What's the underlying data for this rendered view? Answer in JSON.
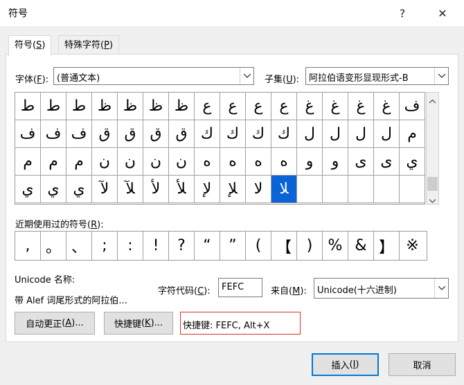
{
  "window": {
    "title": "符号",
    "help_label": "?",
    "close_label": "✕"
  },
  "tabs": [
    {
      "label": "符号",
      "key": "S"
    },
    {
      "label": "特殊字符",
      "key": "P"
    }
  ],
  "font": {
    "label": "字体",
    "key": "F",
    "value": "(普通文本)"
  },
  "subset": {
    "label": "子集",
    "key": "U",
    "value": "阿拉伯语变形显现形式-B"
  },
  "symbols": [
    [
      "ط",
      "ط",
      "ط",
      "ظ",
      "ظ",
      "ظ",
      "ظ",
      "ع",
      "ع",
      "ع",
      "ع",
      "غ",
      "غ",
      "غ",
      "غ",
      "ف"
    ],
    [
      "ف",
      "ف",
      "ف",
      "ق",
      "ق",
      "ق",
      "ق",
      "ك",
      "ك",
      "ك",
      "ك",
      "ل",
      "ل",
      "ل",
      "ل",
      "م"
    ],
    [
      "م",
      "م",
      "م",
      "ن",
      "ن",
      "ن",
      "ن",
      "ه",
      "ه",
      "ه",
      "ه",
      "و",
      "و",
      "ى",
      "ى",
      "ي"
    ],
    [
      "ي",
      "ي",
      "ي",
      "ﻵ",
      "ﻶ",
      "ﻷ",
      "ﻸ",
      "ﻹ",
      "ﻺ",
      "ﻻ",
      "ﻼ",
      "",
      "",
      "",
      "",
      ""
    ]
  ],
  "selected_cell": {
    "row": 3,
    "col": 10
  },
  "recent": {
    "label": "近期使用过的符号",
    "key": "R",
    "items": [
      ",",
      "。",
      "、",
      ";",
      ":",
      "!",
      "?",
      "“",
      "”",
      "(",
      "【",
      ")",
      "%",
      "&",
      "】",
      "※"
    ]
  },
  "unicode_name_label": "Unicode 名称:",
  "char_description": "带 Alef 词尾形式的阿拉伯...",
  "char_code": {
    "label": "字符代码",
    "key": "C",
    "value": "FEFC"
  },
  "from": {
    "label": "来自",
    "key": "M",
    "value": "Unicode(十六进制)"
  },
  "autocorrect_button": {
    "label": "自动更正",
    "key": "A",
    "suffix": "..."
  },
  "shortcut_button": {
    "label": "快捷键",
    "key": "K",
    "suffix": "..."
  },
  "shortcut_text": "快捷键: FEFC, Alt+X",
  "insert_button": {
    "label": "插入",
    "key": "I"
  },
  "cancel_button": {
    "label": "取消"
  },
  "colors": {
    "selection": "#0a64d8",
    "accent": "#0078d7",
    "shortcut_border": "#d93025"
  }
}
